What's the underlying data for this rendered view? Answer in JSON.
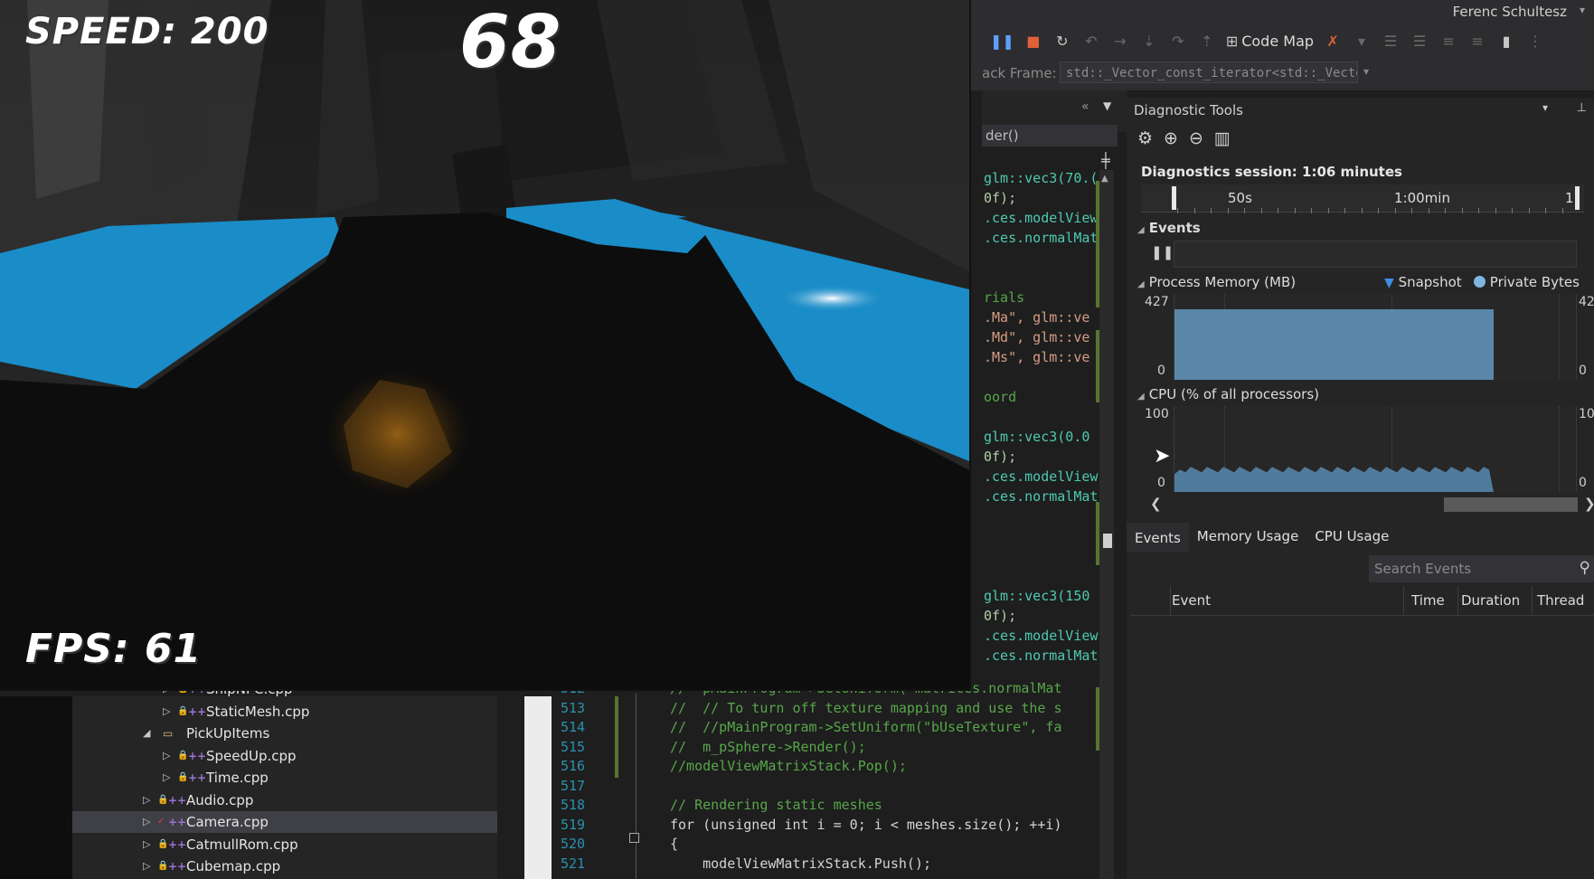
{
  "ide": {
    "user_name": "Ferenc Schultesz",
    "toolbar": {
      "code_map_label": "Code Map"
    },
    "stack_frame": {
      "label": "ack Frame:",
      "value": "std::_Vector_const_iterator<std::_Vector_va"
    },
    "code_nav_value": "der()"
  },
  "code_right_lines": [
    {
      "text": "glm::vec3(70.(",
      "color": "#4ec9b0"
    },
    {
      "text": "0f);",
      "color": "#b5cea8"
    },
    {
      "text": ".ces.modelView",
      "color": "#4ec9b0"
    },
    {
      "text": ".ces.normalMat",
      "color": "#4ec9b0"
    },
    {
      "text": "",
      "color": "#d4d4d4"
    },
    {
      "text": "",
      "color": "#d4d4d4"
    },
    {
      "text": "rials",
      "color": "#57a64a"
    },
    {
      "text": ".Ma\", glm::ve",
      "color": "#d69d85"
    },
    {
      "text": ".Md\", glm::ve",
      "color": "#d69d85"
    },
    {
      "text": ".Ms\", glm::ve",
      "color": "#d69d85"
    },
    {
      "text": "",
      "color": "#d4d4d4"
    },
    {
      "text": "oord",
      "color": "#57a64a"
    },
    {
      "text": "",
      "color": "#d4d4d4"
    },
    {
      "text": "glm::vec3(0.0",
      "color": "#4ec9b0"
    },
    {
      "text": "0f);",
      "color": "#b5cea8"
    },
    {
      "text": ".ces.modelView",
      "color": "#4ec9b0"
    },
    {
      "text": ".ces.normalMat",
      "color": "#4ec9b0"
    },
    {
      "text": "",
      "color": "#d4d4d4"
    },
    {
      "text": "",
      "color": "#d4d4d4"
    },
    {
      "text": "",
      "color": "#d4d4d4"
    },
    {
      "text": "",
      "color": "#d4d4d4"
    },
    {
      "text": "glm::vec3(150",
      "color": "#4ec9b0"
    },
    {
      "text": "0f);",
      "color": "#b5cea8"
    },
    {
      "text": ".ces.modelView",
      "color": "#4ec9b0"
    },
    {
      "text": ".ces.normalMat",
      "color": "#4ec9b0"
    }
  ],
  "diagnostics": {
    "title": "Diagnostic Tools",
    "session": "Diagnostics session: 1:06 minutes",
    "timeline": {
      "labels": [
        "50s",
        "1:00min",
        "1"
      ]
    },
    "events_label": "Events",
    "process_memory": {
      "title": "Process Memory (MB)",
      "legend_snapshot": "Snapshot",
      "legend_private": "Private Bytes",
      "y_max": "427",
      "y_min": "0",
      "y_max_right": "42",
      "y_min_right": "0",
      "fill_color": "#5a87a8"
    },
    "cpu": {
      "title": "CPU (% of all processors)",
      "y_max": "100",
      "y_min": "0",
      "y_max_right": "10",
      "y_min_right": "0",
      "fill_color": "#4f7b9c"
    },
    "tabs": [
      "Events",
      "Memory Usage",
      "CPU Usage"
    ],
    "search_placeholder": "Search Events",
    "columns": [
      "Event",
      "Time",
      "Duration",
      "Thread"
    ]
  },
  "solution_tree": [
    {
      "label": "ShipNPC.cpp",
      "indent": 2,
      "type": "cpp"
    },
    {
      "label": "StaticMesh.cpp",
      "indent": 2,
      "type": "cpp"
    },
    {
      "label": "PickUpItems",
      "indent": 1,
      "type": "folder"
    },
    {
      "label": "SpeedUp.cpp",
      "indent": 2,
      "type": "cpp"
    },
    {
      "label": "Time.cpp",
      "indent": 2,
      "type": "cpp"
    },
    {
      "label": "Audio.cpp",
      "indent": 1,
      "type": "cpp"
    },
    {
      "label": "Camera.cpp",
      "indent": 1,
      "type": "cpp",
      "selected": true
    },
    {
      "label": "CatmullRom.cpp",
      "indent": 1,
      "type": "cpp"
    },
    {
      "label": "Cubemap.cpp",
      "indent": 1,
      "type": "cpp"
    }
  ],
  "lower_code": [
    {
      "num": "512",
      "text": "//  pMainProgram->SetUniform(\"matrices.normalMat",
      "color": "#57a64a"
    },
    {
      "num": "513",
      "text": "//  // To turn off texture mapping and use the s",
      "color": "#57a64a"
    },
    {
      "num": "514",
      "text": "//  //pMainProgram->SetUniform(\"bUseTexture\", fa",
      "color": "#57a64a"
    },
    {
      "num": "515",
      "text": "//  m_pSphere->Render();",
      "color": "#57a64a"
    },
    {
      "num": "516",
      "text": "//modelViewMatrixStack.Pop();",
      "color": "#57a64a"
    },
    {
      "num": "517",
      "text": "",
      "color": "#d4d4d4"
    },
    {
      "num": "518",
      "text": "// Rendering static meshes",
      "color": "#57a64a"
    },
    {
      "num": "519",
      "text": "for (unsigned int i = 0; i < meshes.size(); ++i)",
      "color": "#d4d4d4"
    },
    {
      "num": "520",
      "text": "{",
      "color": "#d4d4d4"
    },
    {
      "num": "521",
      "text": "    modelViewMatrixStack.Push();",
      "color": "#d4d4d4"
    }
  ],
  "game_hud": {
    "speed": "SPEED: 200",
    "timer": "68",
    "fps": "FPS: 61"
  },
  "memory_usage_fraction": 0.82,
  "cpu_level_fraction": 0.25
}
